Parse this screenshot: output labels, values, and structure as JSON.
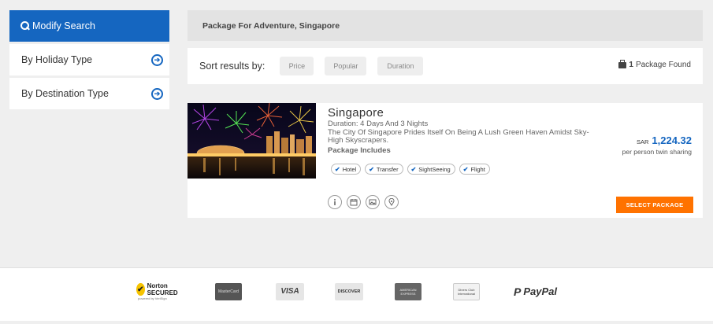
{
  "sidebar": {
    "modify_search": "Modify Search",
    "items": [
      {
        "label": "By Holiday Type"
      },
      {
        "label": "By Destination Type"
      }
    ]
  },
  "header": {
    "title": "Package For Adventure, Singapore"
  },
  "sort": {
    "label": "Sort results by:",
    "options": [
      "Price",
      "Popular",
      "Duration"
    ],
    "count_number": "1",
    "count_text": "Package Found"
  },
  "package": {
    "title": "Singapore",
    "duration": "Duration: 4 Days And 3 Nights",
    "description": "The City Of Singapore Prides Itself On Being A Lush Green Haven Amidst Sky-High Skyscrapers.",
    "includes_label": "Package Includes",
    "includes": [
      "Hotel",
      "Transfer",
      "SightSeeing",
      "Flight"
    ],
    "currency": "SAR",
    "price": "1,224.32",
    "price_note": "per person twin sharing",
    "select_button": "SELECT PACKAGE",
    "action_icons": [
      "info-icon",
      "calendar-icon",
      "gallery-icon",
      "location-pin-icon"
    ]
  },
  "footer": {
    "logos": [
      "Norton SECURED",
      "MasterCard",
      "VISA",
      "DISCOVER",
      "AMERICAN EXPRESS",
      "Diners Club International",
      "PayPal"
    ],
    "norton_sub": "powered by VeriSign"
  },
  "colors": {
    "accent": "#1566c0",
    "cta": "#ff7200",
    "background": "#efefef"
  }
}
